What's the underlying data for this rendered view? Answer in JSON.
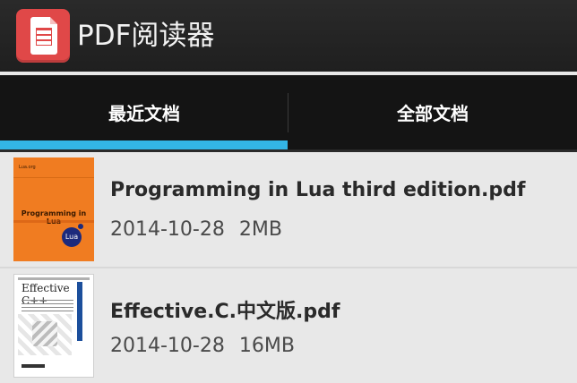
{
  "app": {
    "title": "PDF阅读器",
    "icon": "pdf-document-icon"
  },
  "tabs": [
    {
      "label": "最近文档",
      "selected": true
    },
    {
      "label": "全部文档",
      "selected": false
    }
  ],
  "colors": {
    "actionbar": "#1f1f1f",
    "tabbar": "#141414",
    "tab_indicator": "#33b5e5",
    "list_background": "#e8e8e8",
    "app_icon": "#e04848"
  },
  "files": [
    {
      "name": "Programming in Lua third edition.pdf",
      "date": "2014-10-28",
      "size": "2MB",
      "thumbnail": {
        "small_text": "Lua.org",
        "title": "Programming in Lua",
        "logo": "Lua"
      }
    },
    {
      "name": "Effective.C.中文版.pdf",
      "date": "2014-10-28",
      "size": "16MB",
      "thumbnail": {
        "title": "Effective C++"
      }
    }
  ]
}
